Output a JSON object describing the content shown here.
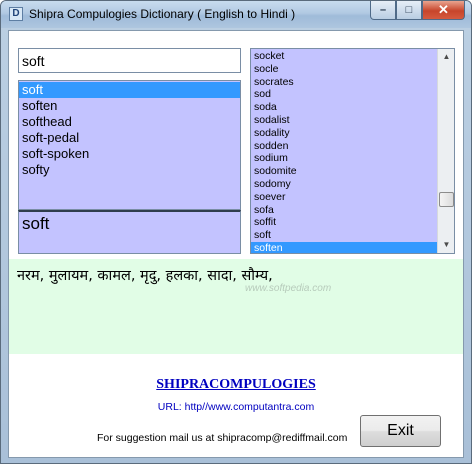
{
  "window": {
    "title": "Shipra Compulogies Dictionary ( English to Hindi )",
    "minimize_glyph": "–",
    "maximize_glyph": "□",
    "close_glyph": "✕"
  },
  "search": {
    "value": "soft"
  },
  "word_list": {
    "items": [
      "soft",
      "soften",
      "softhead",
      "soft-pedal",
      "soft-spoken",
      "softy"
    ],
    "selected_index": 0
  },
  "selected_word": "soft",
  "alpha_list": {
    "items": [
      "socket",
      "socle",
      "socrates",
      "sod",
      "soda",
      "sodalist",
      "sodality",
      "sodden",
      "sodium",
      "sodomite",
      "sodomy",
      "soever",
      "sofa",
      "soffit",
      "soft",
      "soften"
    ],
    "selected_index": 15
  },
  "meaning": "नरम,  मुलायम,  कामल,  मृदु,  हलका,  सादा,  सौम्य,",
  "watermark": "www.softpedia.com",
  "footer": {
    "brand": "SHIPRACOMPULOGIES",
    "url": "URL: http//www.computantra.com",
    "suggestion": "For suggestion mail us at shipracomp@rediffmail.com",
    "exit_label": "Exit"
  },
  "colors": {
    "list_bg": "#c3c3ff",
    "selection": "#3399ff",
    "meaning_bg": "#e1fde6",
    "link": "#0000c0"
  }
}
